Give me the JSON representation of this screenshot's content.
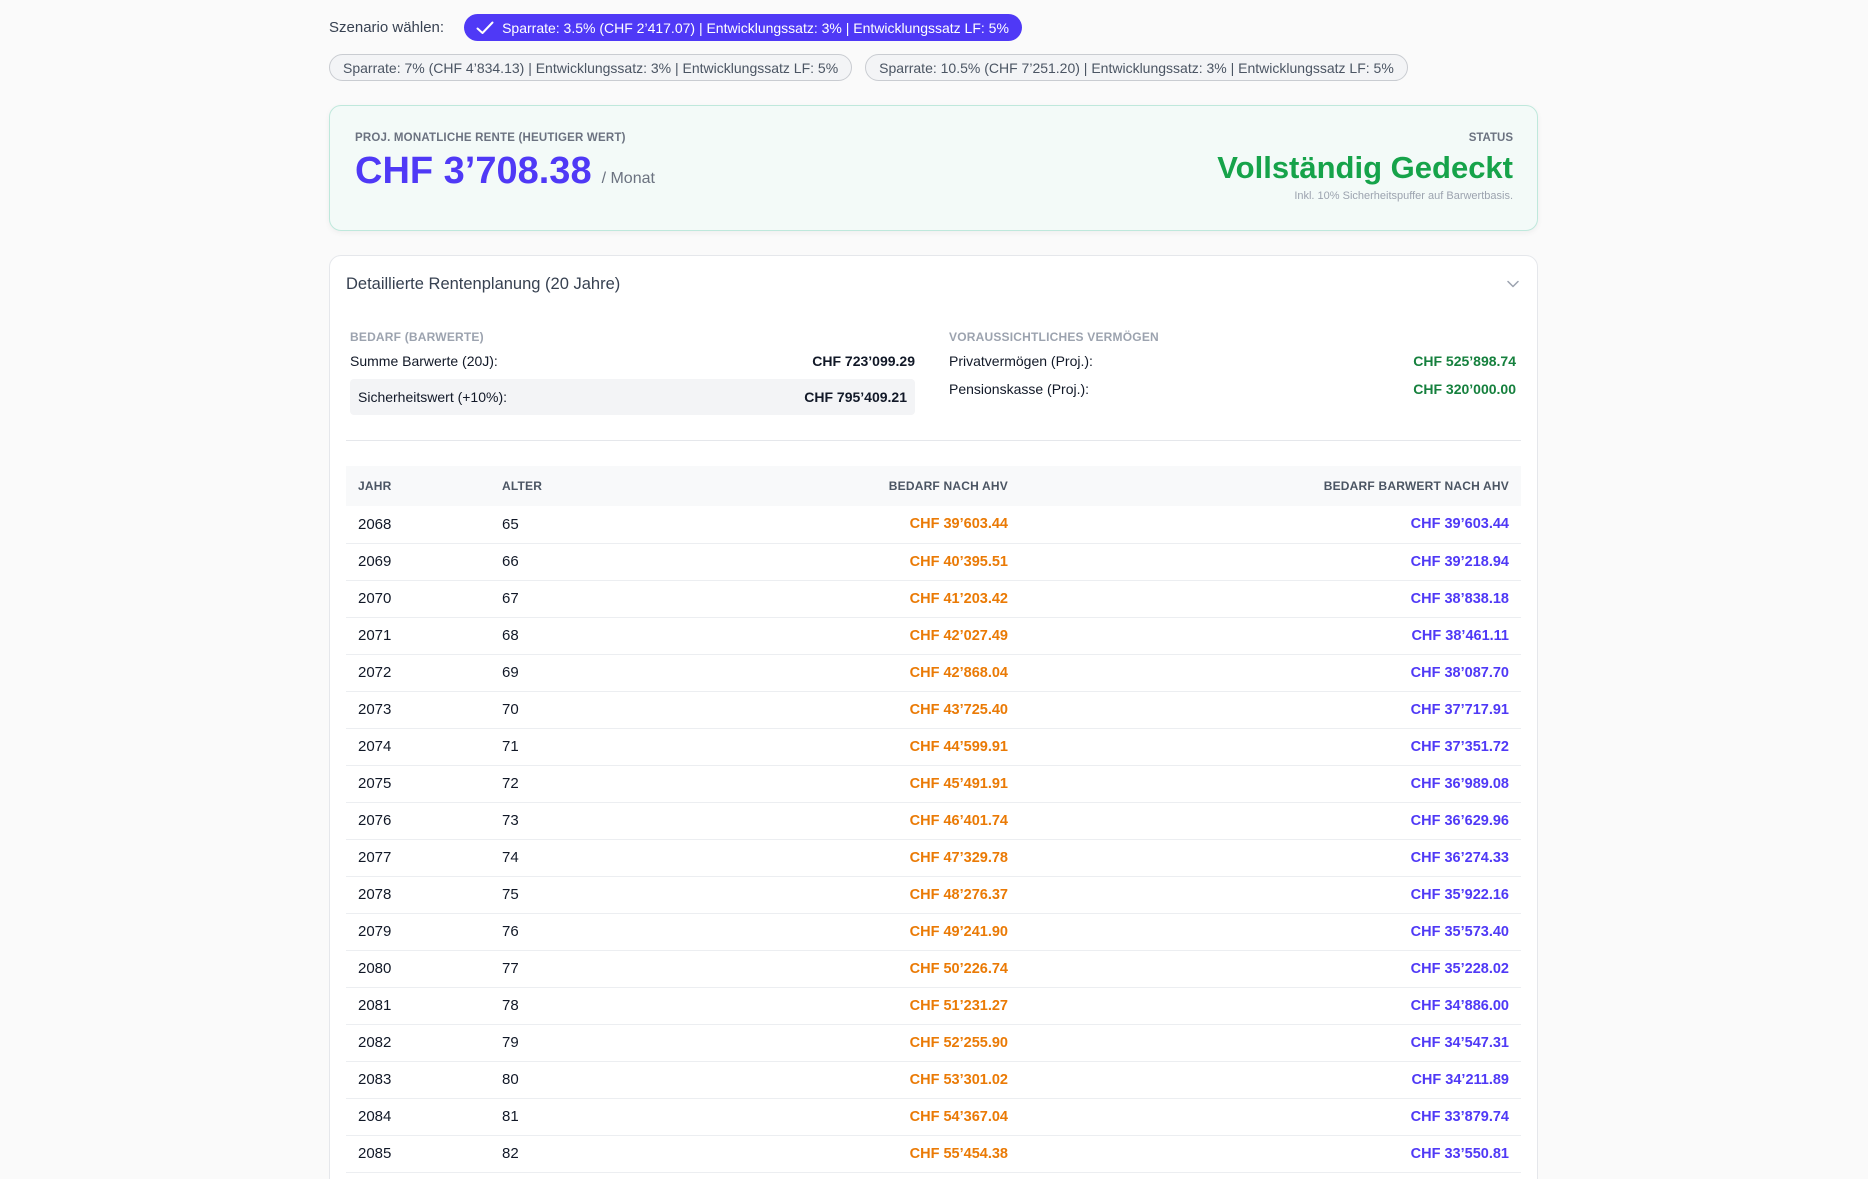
{
  "scenario": {
    "label": "Szenario wählen:",
    "options": [
      {
        "label": "Sparrate: 3.5% (CHF 2’417.07) | Entwicklungssatz: 3% | Entwicklungssatz LF: 5%",
        "selected": true
      },
      {
        "label": "Sparrate: 7% (CHF 4’834.13) | Entwicklungssatz: 3% | Entwicklungssatz LF: 5%",
        "selected": false
      },
      {
        "label": "Sparrate: 10.5% (CHF 7’251.20) | Entwicklungssatz: 3% | Entwicklungssatz LF: 5%",
        "selected": false
      }
    ]
  },
  "summary": {
    "caption": "PROJ. MONATLICHE RENTE (HEUTIGER WERT)",
    "value": "CHF 3’708.38",
    "unit": "/ Monat",
    "status_caption": "STATUS",
    "status_value": "Vollständig Gedeckt",
    "status_note": "Inkl. 10% Sicherheitspuffer auf Barwertbasis."
  },
  "details": {
    "title": "Detaillierte Rentenplanung (20 Jahre)",
    "bedarf": {
      "caption": "BEDARF (BARWERTE)",
      "sum_label": "Summe Barwerte (20J):",
      "sum_value": "CHF 723’099.29",
      "safety_label": "Sicherheitswert (+10%):",
      "safety_value": "CHF 795’409.21"
    },
    "vermoegen": {
      "caption": "VORAUSSICHTLICHES VERMÖGEN",
      "private_label": "Privatvermögen (Proj.):",
      "private_value": "CHF 525’898.74",
      "pension_label": "Pensionskasse (Proj.):",
      "pension_value": "CHF 320’000.00"
    },
    "table": {
      "headers": [
        "JAHR",
        "ALTER",
        "BEDARF NACH AHV",
        "BEDARF BARWERT NACH AHV"
      ],
      "rows": [
        [
          "2068",
          "65",
          "CHF 39’603.44",
          "CHF 39’603.44"
        ],
        [
          "2069",
          "66",
          "CHF 40’395.51",
          "CHF 39’218.94"
        ],
        [
          "2070",
          "67",
          "CHF 41’203.42",
          "CHF 38’838.18"
        ],
        [
          "2071",
          "68",
          "CHF 42’027.49",
          "CHF 38’461.11"
        ],
        [
          "2072",
          "69",
          "CHF 42’868.04",
          "CHF 38’087.70"
        ],
        [
          "2073",
          "70",
          "CHF 43’725.40",
          "CHF 37’717.91"
        ],
        [
          "2074",
          "71",
          "CHF 44’599.91",
          "CHF 37’351.72"
        ],
        [
          "2075",
          "72",
          "CHF 45’491.91",
          "CHF 36’989.08"
        ],
        [
          "2076",
          "73",
          "CHF 46’401.74",
          "CHF 36’629.96"
        ],
        [
          "2077",
          "74",
          "CHF 47’329.78",
          "CHF 36’274.33"
        ],
        [
          "2078",
          "75",
          "CHF 48’276.37",
          "CHF 35’922.16"
        ],
        [
          "2079",
          "76",
          "CHF 49’241.90",
          "CHF 35’573.40"
        ],
        [
          "2080",
          "77",
          "CHF 50’226.74",
          "CHF 35’228.02"
        ],
        [
          "2081",
          "78",
          "CHF 51’231.27",
          "CHF 34’886.00"
        ],
        [
          "2082",
          "79",
          "CHF 52’255.90",
          "CHF 34’547.31"
        ],
        [
          "2083",
          "80",
          "CHF 53’301.02",
          "CHF 34’211.89"
        ],
        [
          "2084",
          "81",
          "CHF 54’367.04",
          "CHF 33’879.74"
        ],
        [
          "2085",
          "82",
          "CHF 55’454.38",
          "CHF 33’550.81"
        ]
      ]
    }
  },
  "icons": {
    "selected": "check-icon",
    "collapse": "chevron-down-icon"
  },
  "colors": {
    "accent": "#4f39f6",
    "success": "#16a34a",
    "need": "#ea7a05"
  }
}
